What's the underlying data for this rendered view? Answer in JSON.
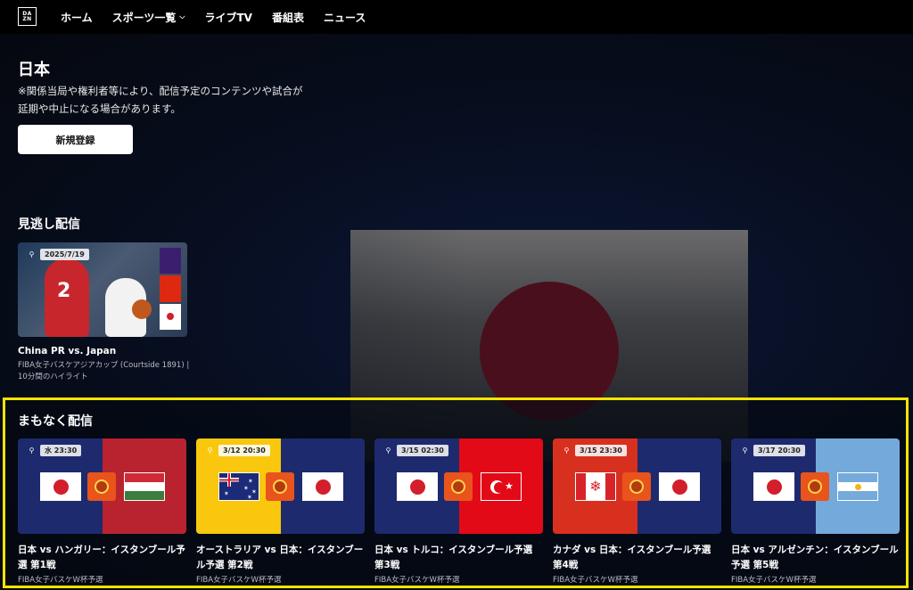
{
  "nav": {
    "logo_top": "DA",
    "logo_bottom": "ZN",
    "items": [
      "ホーム",
      "スポーツ一覧",
      "ライブTV",
      "番組表",
      "ニュース"
    ]
  },
  "hero": {
    "title": "日本",
    "notice": "※関係当局や権利者等により、配信予定のコンテンツや試合が延期や中止になる場合があります。",
    "register_button": "新規登録"
  },
  "missed": {
    "section_title": "見逃し配信",
    "card": {
      "date": "2025/7/19",
      "player_number": "2",
      "title": "China PR vs. Japan",
      "subtitle": "FIBA女子バスケアジアカップ (Courtside 1891) | 10分間のハイライト"
    }
  },
  "upcoming": {
    "section_title": "まもなく配信",
    "cards": [
      {
        "date": "水 23:30",
        "title": "日本 vs ハンガリー：イスタンブール予選 第1戦",
        "subtitle": "FIBA女子バスケW杯予選",
        "left_color": "#1e2a6e",
        "right_color": "#b8232f",
        "left_flag": "japan",
        "right_flag": "hungary"
      },
      {
        "date": "3/12 20:30",
        "title": "オーストラリア vs 日本：イスタンブール予選 第2戦",
        "subtitle": "FIBA女子バスケW杯予選",
        "left_color": "#f9c80e",
        "right_color": "#1e2a6e",
        "left_flag": "australia",
        "right_flag": "japan"
      },
      {
        "date": "3/15 02:30",
        "title": "日本 vs トルコ：イスタンブール予選 第3戦",
        "subtitle": "FIBA女子バスケW杯予選",
        "left_color": "#1e2a6e",
        "right_color": "#e30a17",
        "left_flag": "japan",
        "right_flag": "turkey"
      },
      {
        "date": "3/15 23:30",
        "title": "カナダ vs 日本：イスタンブール予選 第4戦",
        "subtitle": "FIBA女子バスケW杯予選",
        "left_color": "#d8301f",
        "right_color": "#1e2a6e",
        "left_flag": "canada",
        "right_flag": "japan"
      },
      {
        "date": "3/17 20:30",
        "title": "日本 vs アルゼンチン：イスタンブール予選 第5戦",
        "subtitle": "FIBA女子バスケW杯予選",
        "left_color": "#1e2a6e",
        "right_color": "#74aadb",
        "left_flag": "japan",
        "right_flag": "argentina"
      }
    ]
  },
  "colors": {
    "background": "#060b16",
    "highlight_border": "#f5e400",
    "emblem": "#e8541b"
  },
  "icons": [
    "lock-icon",
    "chevron-down-icon",
    "fiba-emblem-icon"
  ]
}
